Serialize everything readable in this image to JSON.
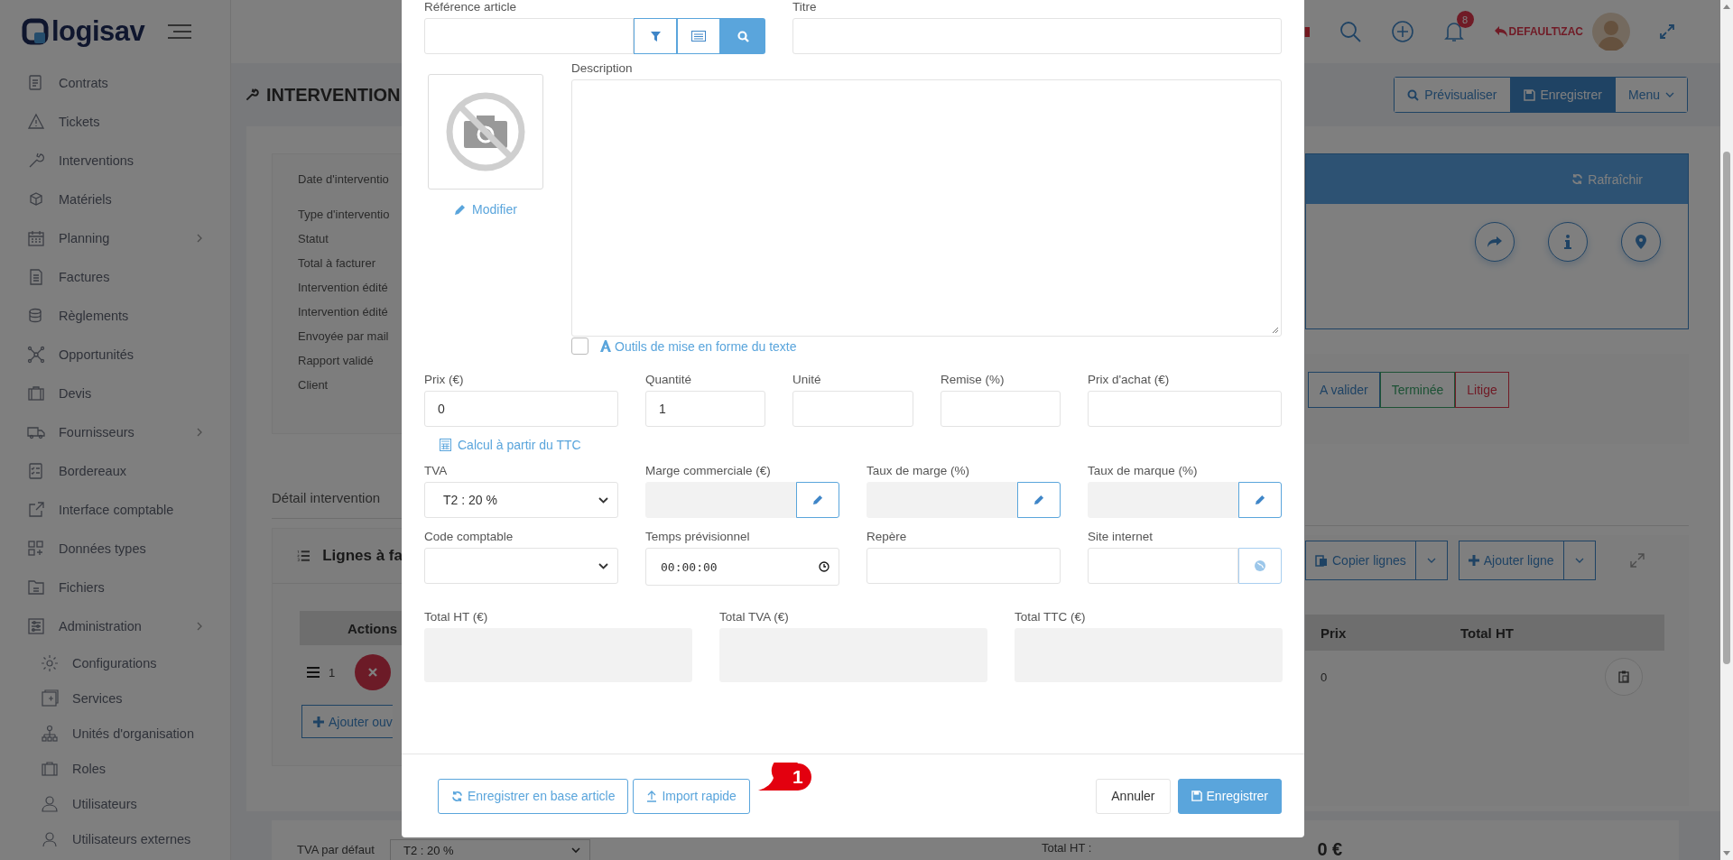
{
  "sidebar": {
    "logo": "logisav",
    "items": [
      {
        "label": "Contrats",
        "expandable": false
      },
      {
        "label": "Tickets",
        "expandable": false
      },
      {
        "label": "Interventions",
        "expandable": false
      },
      {
        "label": "Matériels",
        "expandable": false
      },
      {
        "label": "Planning",
        "expandable": true
      },
      {
        "label": "Factures",
        "expandable": false
      },
      {
        "label": "Règlements",
        "expandable": false
      },
      {
        "label": "Opportunités",
        "expandable": false
      },
      {
        "label": "Devis",
        "expandable": false
      },
      {
        "label": "Fournisseurs",
        "expandable": true
      },
      {
        "label": "Bordereaux",
        "expandable": false
      },
      {
        "label": "Interface comptable",
        "expandable": false
      },
      {
        "label": "Données types",
        "expandable": false
      },
      {
        "label": "Fichiers",
        "expandable": false
      },
      {
        "label": "Administration",
        "expandable": true,
        "children": [
          {
            "label": "Configurations"
          },
          {
            "label": "Services"
          },
          {
            "label": "Unités d'organisation"
          },
          {
            "label": "Roles"
          },
          {
            "label": "Utilisateurs"
          },
          {
            "label": "Utilisateurs externes"
          }
        ]
      }
    ]
  },
  "header": {
    "notifications": "8",
    "user": "DEFAULT\\ZAC"
  },
  "page": {
    "title": "INTERVENTION",
    "actions": [
      {
        "label": "Prévisualiser",
        "kind": "preview"
      },
      {
        "label": "Enregistrer",
        "kind": "save"
      },
      {
        "label": "Menu",
        "kind": "dropdown"
      }
    ]
  },
  "summary": {
    "fields": [
      "Date d'interventio",
      "Type d'interventio",
      "Statut",
      "Total à facturer",
      "Intervention édité",
      "Intervention édité",
      "Envoyée par mail",
      "Rapport validé",
      "Client"
    ],
    "refresh": "Rafraîchir"
  },
  "statuses": [
    {
      "label": "A valider",
      "kind": "pending"
    },
    {
      "label": "Terminée",
      "kind": "done"
    },
    {
      "label": "Litige",
      "kind": "dispute"
    }
  ],
  "detail_tab": "Détail intervention",
  "lines": {
    "title": "Lignes à fa",
    "copy": "Copier lignes",
    "add": "Ajouter ligne",
    "columns": [
      "Actions",
      "Prix",
      "Total HT"
    ],
    "rows": [
      {
        "number": "1",
        "price": "0"
      }
    ],
    "add_work": "Ajouter ouv"
  },
  "footer": {
    "vat_label": "TVA par défaut",
    "vat_value": "T2 : 20 %",
    "total_label": "Total HT :",
    "total_value": "0 €"
  },
  "modal": {
    "reference": {
      "label": "Référence article"
    },
    "title_field": {
      "label": "Titre"
    },
    "image_action": "Modifier",
    "description": {
      "label": "Description"
    },
    "formatting": {
      "label": "Outils de mise en forme du texte",
      "checked": false
    },
    "row1": [
      {
        "label": "Prix (€)",
        "kind": "text",
        "value": "0"
      },
      {
        "label": "Quantité",
        "kind": "text",
        "value": "1"
      },
      {
        "label": "Unité",
        "kind": "text"
      },
      {
        "label": "Remise (%)",
        "kind": "text"
      },
      {
        "label": "Prix d'achat (€)",
        "kind": "text"
      }
    ],
    "calc_link": "Calcul à partir du TTC",
    "row2": [
      {
        "label": "TVA",
        "kind": "select",
        "value": "T2 : 20 %"
      },
      {
        "label": "Marge commerciale (€)",
        "kind": "edit"
      },
      {
        "label": "Taux de marge (%)",
        "kind": "edit"
      },
      {
        "label": "Taux de marque (%)",
        "kind": "edit"
      }
    ],
    "row3": [
      {
        "label": "Code comptable",
        "kind": "select"
      },
      {
        "label": "Temps prévisionnel",
        "kind": "time",
        "value": "00:00:00"
      },
      {
        "label": "Repère",
        "kind": "text"
      },
      {
        "label": "Site internet",
        "kind": "url"
      }
    ],
    "totals": [
      {
        "label": "Total HT (€)"
      },
      {
        "label": "Total TVA (€)"
      },
      {
        "label": "Total TTC (€)"
      }
    ],
    "buttons": [
      {
        "label": "Enregistrer en base article",
        "kind": "sync"
      },
      {
        "label": "Import rapide",
        "kind": "upload"
      },
      {
        "label": "Annuler",
        "kind": "cancel"
      },
      {
        "label": "Enregistrer",
        "kind": "save"
      }
    ],
    "callout": "1"
  }
}
